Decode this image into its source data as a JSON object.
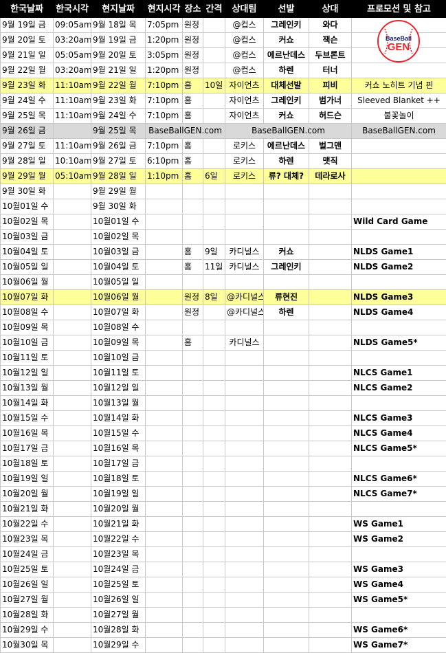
{
  "headers": [
    "한국날짜",
    "한국시각",
    "현지날짜",
    "현지시각",
    "장소",
    "간격",
    "상대팀",
    "선발",
    "상대",
    "프로모션 및 참고"
  ],
  "logo_text": {
    "line1": "BaseBall",
    "line2": "GEN"
  },
  "colors": {
    "header_bg": "#000000",
    "header_text": "#ffffff",
    "highlight_yellow": "#ffff99",
    "highlight_gray": "#d9d9d9",
    "logo_red": "#e8262c"
  },
  "rows": [
    {
      "kdate": "9월 19일 금",
      "ktime": "09:05am",
      "ldate": "9월 18일 목",
      "ltime": "7:05pm",
      "place": "원정",
      "gap": "",
      "opp_team": "@컵스",
      "starter": "그레인키",
      "opp_sp": "와다",
      "promo": "",
      "style": ""
    },
    {
      "kdate": "9월 20일 토",
      "ktime": "03:20am",
      "ldate": "9월 19일 금",
      "ltime": "1:20pm",
      "place": "원정",
      "gap": "",
      "opp_team": "@컵스",
      "starter": "커쇼",
      "opp_sp": "잭슨",
      "promo": "",
      "style": ""
    },
    {
      "kdate": "9월 21일 일",
      "ktime": "05:05am",
      "ldate": "9월 20일 토",
      "ltime": "3:05pm",
      "place": "원정",
      "gap": "",
      "opp_team": "@컵스",
      "starter": "에르난데스",
      "opp_sp": "두브론트",
      "promo": "",
      "style": ""
    },
    {
      "kdate": "9월 22일 월",
      "ktime": "03:20am",
      "ldate": "9월 21일 일",
      "ltime": "1:20pm",
      "place": "원정",
      "gap": "",
      "opp_team": "@컵스",
      "starter": "하렌",
      "opp_sp": "터너",
      "promo": "",
      "style": ""
    },
    {
      "kdate": "9월 23일 화",
      "ktime": "11:10am",
      "ldate": "9월 22일 월",
      "ltime": "7:10pm",
      "place": "홈",
      "gap": "10일",
      "opp_team": "자이언츠",
      "starter": "대체선발",
      "opp_sp": "피비",
      "promo": "커쇼 노히트 기념 핀",
      "style": "yellow"
    },
    {
      "kdate": "9월 24일 수",
      "ktime": "11:10am",
      "ldate": "9월 23일 화",
      "ltime": "7:10pm",
      "place": "홈",
      "gap": "",
      "opp_team": "자이언츠",
      "starter": "그레인키",
      "opp_sp": "범가너",
      "promo": "Sleeved Blanket ++",
      "style": ""
    },
    {
      "kdate": "9월 25일 목",
      "ktime": "11:10am",
      "ldate": "9월 24일 수",
      "ltime": "7:10pm",
      "place": "홈",
      "gap": "",
      "opp_team": "자이언츠",
      "starter": "커쇼",
      "opp_sp": "허드슨",
      "promo": "불꽃놀이",
      "style": ""
    },
    {
      "kdate": "9월 26일 금",
      "ktime": "",
      "ldate": "9월 25일 목",
      "ltime": "",
      "place": "",
      "gap": "",
      "opp_team": "",
      "starter": "",
      "opp_sp": "",
      "promo": "",
      "style": "gray",
      "watermarks": [
        "BaseBallGEN.com",
        "BaseBallGEN.com",
        "BaseBallGEN.com"
      ]
    },
    {
      "kdate": "9월 27일 토",
      "ktime": "11:10am",
      "ldate": "9월 26일 금",
      "ltime": "7:10pm",
      "place": "홈",
      "gap": "",
      "opp_team": "로키스",
      "starter": "에르난데스",
      "opp_sp": "벌그맨",
      "promo": "",
      "style": ""
    },
    {
      "kdate": "9월 28일 일",
      "ktime": "10:10am",
      "ldate": "9월 27일 토",
      "ltime": "6:10pm",
      "place": "홈",
      "gap": "",
      "opp_team": "로키스",
      "starter": "하렌",
      "opp_sp": "맷직",
      "promo": "",
      "style": ""
    },
    {
      "kdate": "9월 29일 월",
      "ktime": "05:10am",
      "ldate": "9월 28일 일",
      "ltime": "1:10pm",
      "place": "홈",
      "gap": "6일",
      "opp_team": "로키스",
      "starter": "류? 대체?",
      "opp_sp": "데라로사",
      "promo": "",
      "style": "yellow"
    },
    {
      "kdate": "9월 30일 화",
      "ktime": "",
      "ldate": "9월 29일 월",
      "ltime": "",
      "place": "",
      "gap": "",
      "opp_team": "",
      "starter": "",
      "opp_sp": "",
      "promo": "",
      "style": ""
    },
    {
      "kdate": "10월01일 수",
      "ktime": "",
      "ldate": "9월 30일 화",
      "ltime": "",
      "place": "",
      "gap": "",
      "opp_team": "",
      "starter": "",
      "opp_sp": "",
      "promo": "",
      "style": ""
    },
    {
      "kdate": "10월02일 목",
      "ktime": "",
      "ldate": "10월01일 수",
      "ltime": "",
      "place": "",
      "gap": "",
      "opp_team": "",
      "starter": "",
      "opp_sp": "",
      "promo": "Wild Card Game",
      "style": ""
    },
    {
      "kdate": "10월03일 금",
      "ktime": "",
      "ldate": "10월02일 목",
      "ltime": "",
      "place": "",
      "gap": "",
      "opp_team": "",
      "starter": "",
      "opp_sp": "",
      "promo": "",
      "style": ""
    },
    {
      "kdate": "10월04일 토",
      "ktime": "",
      "ldate": "10월03일 금",
      "ltime": "",
      "place": "홈",
      "gap": "9일",
      "opp_team": "카디널스",
      "starter": "커쇼",
      "opp_sp": "",
      "promo": "NLDS Game1",
      "style": ""
    },
    {
      "kdate": "10월05일 일",
      "ktime": "",
      "ldate": "10월04일 토",
      "ltime": "",
      "place": "홈",
      "gap": "11일",
      "opp_team": "카디널스",
      "starter": "그레인키",
      "opp_sp": "",
      "promo": "NLDS Game2",
      "style": ""
    },
    {
      "kdate": "10월06일 월",
      "ktime": "",
      "ldate": "10월05일 일",
      "ltime": "",
      "place": "",
      "gap": "",
      "opp_team": "",
      "starter": "",
      "opp_sp": "",
      "promo": "",
      "style": ""
    },
    {
      "kdate": "10월07일 화",
      "ktime": "",
      "ldate": "10월06일 월",
      "ltime": "",
      "place": "원정",
      "gap": "8일",
      "opp_team": "@카디널스",
      "starter": "류현진",
      "opp_sp": "",
      "promo": "NLDS Game3",
      "style": "yellow"
    },
    {
      "kdate": "10월08일 수",
      "ktime": "",
      "ldate": "10월07일 화",
      "ltime": "",
      "place": "원정",
      "gap": "",
      "opp_team": "@카디널스",
      "starter": "하렌",
      "opp_sp": "",
      "promo": "NLDS Game4",
      "style": ""
    },
    {
      "kdate": "10월09일 목",
      "ktime": "",
      "ldate": "10월08일 수",
      "ltime": "",
      "place": "",
      "gap": "",
      "opp_team": "",
      "starter": "",
      "opp_sp": "",
      "promo": "",
      "style": ""
    },
    {
      "kdate": "10월10일 금",
      "ktime": "",
      "ldate": "10월09일 목",
      "ltime": "",
      "place": "홈",
      "gap": "",
      "opp_team": "카디널스",
      "starter": "",
      "opp_sp": "",
      "promo": "NLDS Game5*",
      "style": ""
    },
    {
      "kdate": "10월11일 토",
      "ktime": "",
      "ldate": "10월10일 금",
      "ltime": "",
      "place": "",
      "gap": "",
      "opp_team": "",
      "starter": "",
      "opp_sp": "",
      "promo": "",
      "style": ""
    },
    {
      "kdate": "10월12일 일",
      "ktime": "",
      "ldate": "10월11일 토",
      "ltime": "",
      "place": "",
      "gap": "",
      "opp_team": "",
      "starter": "",
      "opp_sp": "",
      "promo": "NLCS Game1",
      "style": ""
    },
    {
      "kdate": "10월13일 월",
      "ktime": "",
      "ldate": "10월12일 일",
      "ltime": "",
      "place": "",
      "gap": "",
      "opp_team": "",
      "starter": "",
      "opp_sp": "",
      "promo": "NLCS Game2",
      "style": ""
    },
    {
      "kdate": "10월14일 화",
      "ktime": "",
      "ldate": "10월13일 월",
      "ltime": "",
      "place": "",
      "gap": "",
      "opp_team": "",
      "starter": "",
      "opp_sp": "",
      "promo": "",
      "style": ""
    },
    {
      "kdate": "10월15일 수",
      "ktime": "",
      "ldate": "10월14일 화",
      "ltime": "",
      "place": "",
      "gap": "",
      "opp_team": "",
      "starter": "",
      "opp_sp": "",
      "promo": "NLCS Game3",
      "style": ""
    },
    {
      "kdate": "10월16일 목",
      "ktime": "",
      "ldate": "10월15일 수",
      "ltime": "",
      "place": "",
      "gap": "",
      "opp_team": "",
      "starter": "",
      "opp_sp": "",
      "promo": "NLCS Game4",
      "style": ""
    },
    {
      "kdate": "10월17일 금",
      "ktime": "",
      "ldate": "10월16일 목",
      "ltime": "",
      "place": "",
      "gap": "",
      "opp_team": "",
      "starter": "",
      "opp_sp": "",
      "promo": "NLCS Game5*",
      "style": ""
    },
    {
      "kdate": "10월18일 토",
      "ktime": "",
      "ldate": "10월17일 금",
      "ltime": "",
      "place": "",
      "gap": "",
      "opp_team": "",
      "starter": "",
      "opp_sp": "",
      "promo": "",
      "style": ""
    },
    {
      "kdate": "10월19일 일",
      "ktime": "",
      "ldate": "10월18일 토",
      "ltime": "",
      "place": "",
      "gap": "",
      "opp_team": "",
      "starter": "",
      "opp_sp": "",
      "promo": "NLCS Game6*",
      "style": ""
    },
    {
      "kdate": "10월20일 월",
      "ktime": "",
      "ldate": "10월19일 일",
      "ltime": "",
      "place": "",
      "gap": "",
      "opp_team": "",
      "starter": "",
      "opp_sp": "",
      "promo": "NLCS Game7*",
      "style": ""
    },
    {
      "kdate": "10월21일 화",
      "ktime": "",
      "ldate": "10월20일 월",
      "ltime": "",
      "place": "",
      "gap": "",
      "opp_team": "",
      "starter": "",
      "opp_sp": "",
      "promo": "",
      "style": ""
    },
    {
      "kdate": "10월22일 수",
      "ktime": "",
      "ldate": "10월21일 화",
      "ltime": "",
      "place": "",
      "gap": "",
      "opp_team": "",
      "starter": "",
      "opp_sp": "",
      "promo": "WS Game1",
      "style": ""
    },
    {
      "kdate": "10월23일 목",
      "ktime": "",
      "ldate": "10월22일 수",
      "ltime": "",
      "place": "",
      "gap": "",
      "opp_team": "",
      "starter": "",
      "opp_sp": "",
      "promo": "WS Game2",
      "style": ""
    },
    {
      "kdate": "10월24일 금",
      "ktime": "",
      "ldate": "10월23일 목",
      "ltime": "",
      "place": "",
      "gap": "",
      "opp_team": "",
      "starter": "",
      "opp_sp": "",
      "promo": "",
      "style": ""
    },
    {
      "kdate": "10월25일 토",
      "ktime": "",
      "ldate": "10월24일 금",
      "ltime": "",
      "place": "",
      "gap": "",
      "opp_team": "",
      "starter": "",
      "opp_sp": "",
      "promo": "WS Game3",
      "style": ""
    },
    {
      "kdate": "10월26일 일",
      "ktime": "",
      "ldate": "10월25일 토",
      "ltime": "",
      "place": "",
      "gap": "",
      "opp_team": "",
      "starter": "",
      "opp_sp": "",
      "promo": "WS Game4",
      "style": ""
    },
    {
      "kdate": "10월27일 월",
      "ktime": "",
      "ldate": "10월26일 일",
      "ltime": "",
      "place": "",
      "gap": "",
      "opp_team": "",
      "starter": "",
      "opp_sp": "",
      "promo": "WS Game5*",
      "style": ""
    },
    {
      "kdate": "10월28일 화",
      "ktime": "",
      "ldate": "10월27일 월",
      "ltime": "",
      "place": "",
      "gap": "",
      "opp_team": "",
      "starter": "",
      "opp_sp": "",
      "promo": "",
      "style": ""
    },
    {
      "kdate": "10월29일 수",
      "ktime": "",
      "ldate": "10월28일 화",
      "ltime": "",
      "place": "",
      "gap": "",
      "opp_team": "",
      "starter": "",
      "opp_sp": "",
      "promo": "WS Game6*",
      "style": ""
    },
    {
      "kdate": "10월30일 목",
      "ktime": "",
      "ldate": "10월29일 수",
      "ltime": "",
      "place": "",
      "gap": "",
      "opp_team": "",
      "starter": "",
      "opp_sp": "",
      "promo": "WS Game7*",
      "style": ""
    }
  ]
}
